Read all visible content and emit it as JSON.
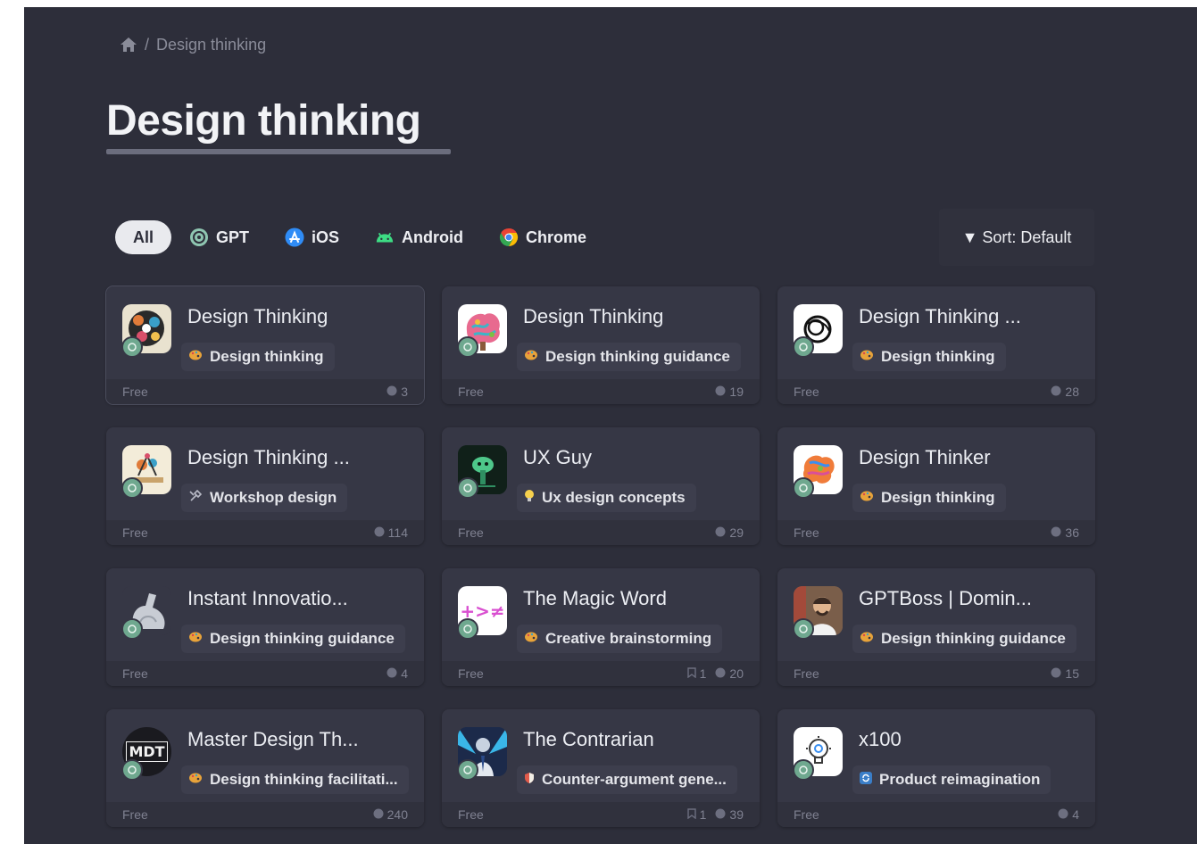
{
  "breadcrumb": {
    "home_icon": "home-icon",
    "separator": "/",
    "current": "Design thinking"
  },
  "page_title": "Design thinking",
  "filters": [
    {
      "label": "All",
      "icon": ""
    },
    {
      "label": "GPT",
      "icon": "openai-icon"
    },
    {
      "label": "iOS",
      "icon": "app-store-icon"
    },
    {
      "label": "Android",
      "icon": "android-icon"
    },
    {
      "label": "Chrome",
      "icon": "chrome-icon"
    }
  ],
  "sort_label": "▼ Sort: Default",
  "cards": [
    {
      "name": "Design Thinking",
      "tag": "Design thinking",
      "tag_icon": "palette-icon",
      "price": "Free",
      "uses": "3",
      "saves": ""
    },
    {
      "name": "Design Thinking",
      "tag": "Design thinking guidance",
      "tag_icon": "palette-icon",
      "price": "Free",
      "uses": "19",
      "saves": ""
    },
    {
      "name": "Design Thinking ...",
      "tag": "Design thinking",
      "tag_icon": "palette-icon",
      "price": "Free",
      "uses": "28",
      "saves": ""
    },
    {
      "name": "Design Thinking ...",
      "tag": "Workshop design",
      "tag_icon": "tools-icon",
      "price": "Free",
      "uses": "114",
      "saves": ""
    },
    {
      "name": "UX Guy",
      "tag": "Ux design concepts",
      "tag_icon": "lightbulb-icon",
      "price": "Free",
      "uses": "29",
      "saves": ""
    },
    {
      "name": "Design Thinker",
      "tag": "Design thinking",
      "tag_icon": "palette-icon",
      "price": "Free",
      "uses": "36",
      "saves": ""
    },
    {
      "name": "Instant Innovatio...",
      "tag": "Design thinking guidance",
      "tag_icon": "palette-icon",
      "price": "Free",
      "uses": "4",
      "saves": ""
    },
    {
      "name": "The Magic Word",
      "tag": "Creative brainstorming",
      "tag_icon": "palette-icon",
      "price": "Free",
      "uses": "20",
      "saves": "1"
    },
    {
      "name": "GPTBoss | Domin...",
      "tag": "Design thinking guidance",
      "tag_icon": "palette-icon",
      "price": "Free",
      "uses": "15",
      "saves": ""
    },
    {
      "name": "Master Design Th...",
      "tag": "Design thinking facilitati...",
      "tag_icon": "palette-icon",
      "price": "Free",
      "uses": "240",
      "saves": ""
    },
    {
      "name": "The Contrarian",
      "tag": "Counter-argument gene...",
      "tag_icon": "shield-icon",
      "price": "Free",
      "uses": "39",
      "saves": "1"
    },
    {
      "name": "x100",
      "tag": "Product reimagination",
      "tag_icon": "refresh-icon",
      "price": "Free",
      "uses": "4",
      "saves": ""
    }
  ],
  "avatar_texts": {
    "mdt": "MDT",
    "magic": "+>≠"
  },
  "colors": {
    "background": "#2d2e3a",
    "card": "#363745",
    "footer": "#30313d",
    "accent_gpt": "#6fa88f"
  }
}
